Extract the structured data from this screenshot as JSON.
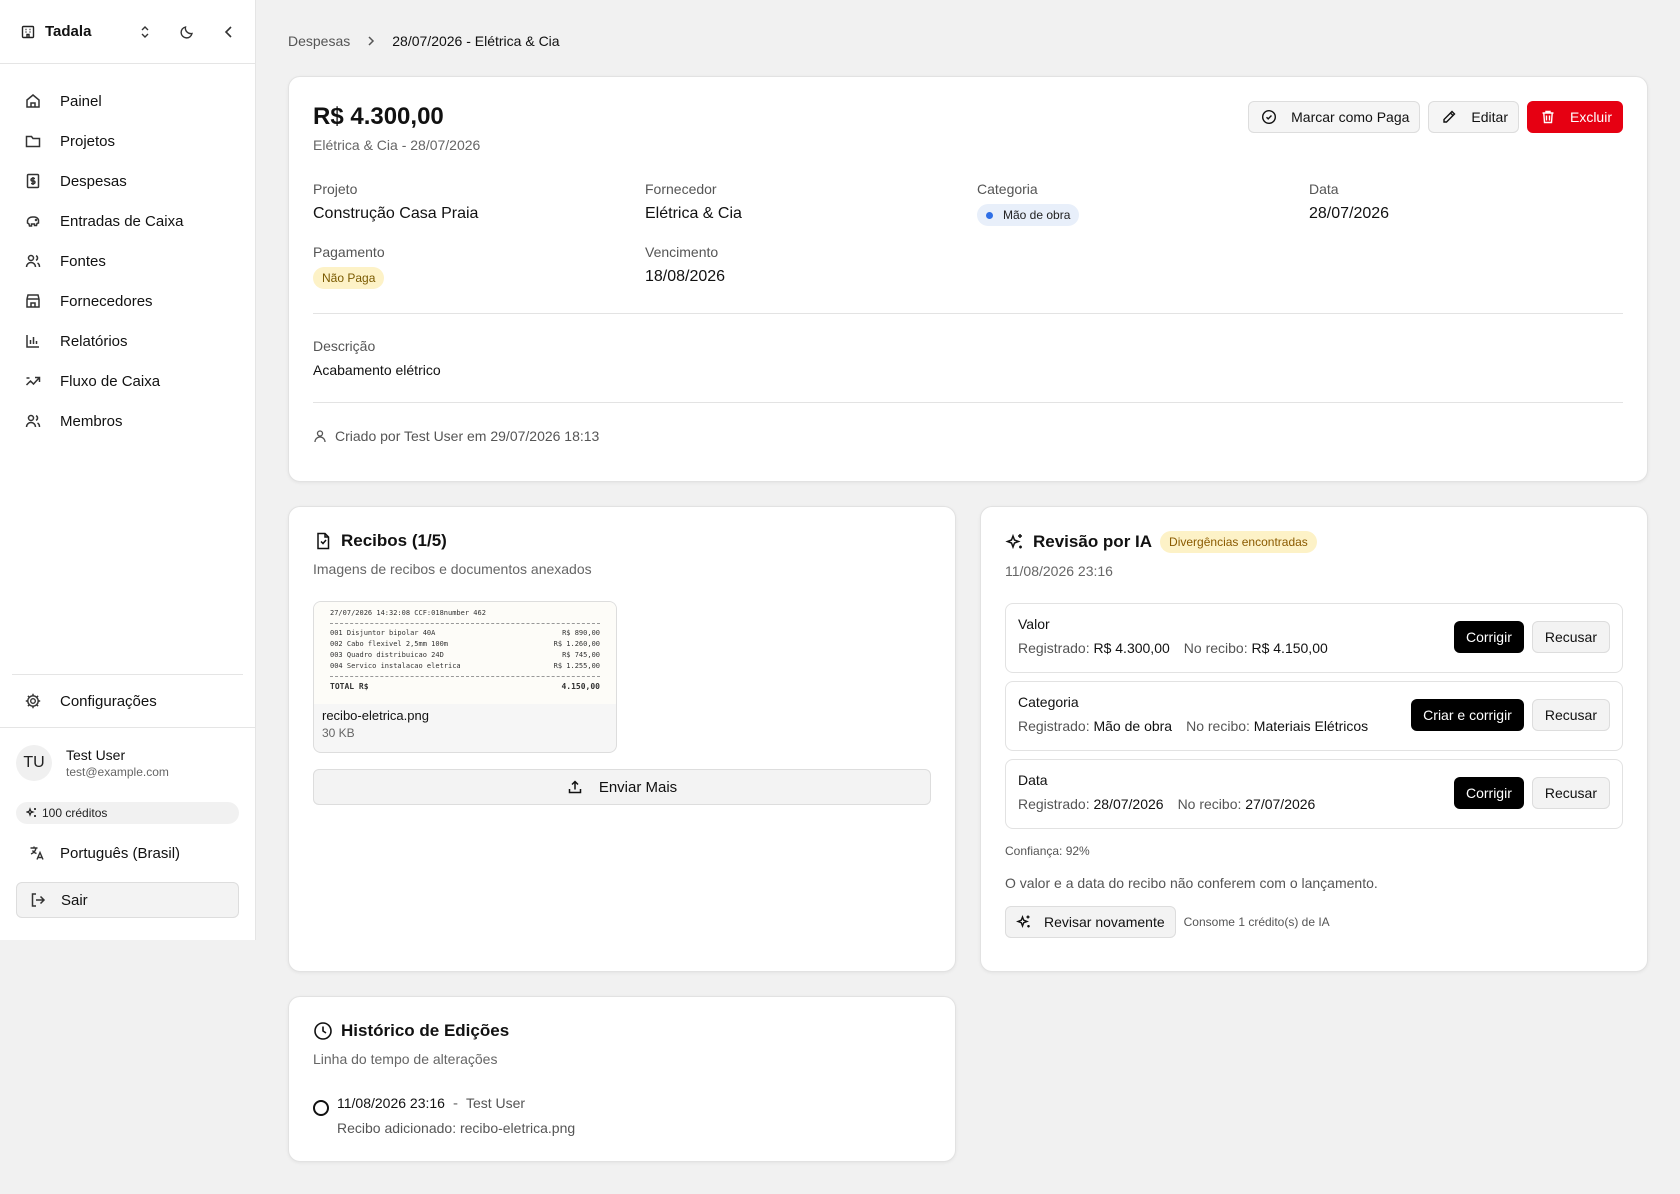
{
  "app": {
    "name": "Tadala"
  },
  "nav": [
    {
      "label": "Painel",
      "icon": "home-icon"
    },
    {
      "label": "Projetos",
      "icon": "folder-icon"
    },
    {
      "label": "Despesas",
      "icon": "receipt-icon"
    },
    {
      "label": "Entradas de Caixa",
      "icon": "piggy-bank-icon"
    },
    {
      "label": "Fontes",
      "icon": "users-icon"
    },
    {
      "label": "Fornecedores",
      "icon": "store-icon"
    },
    {
      "label": "Relatórios",
      "icon": "bar-chart-icon"
    },
    {
      "label": "Fluxo de Caixa",
      "icon": "flow-icon"
    },
    {
      "label": "Membros",
      "icon": "members-icon"
    }
  ],
  "sidebar": {
    "settings": "Configurações",
    "user": {
      "initials": "TU",
      "name": "Test User",
      "email": "test@example.com"
    },
    "credits": "100 créditos",
    "language": "Português (Brasil)",
    "logout": "Sair"
  },
  "breadcrumb": {
    "parent": "Despesas",
    "current": "28/07/2026 - Elétrica & Cia"
  },
  "expense": {
    "amount": "R$ 4.300,00",
    "subtitle": "Elétrica & Cia - 28/07/2026",
    "actions": {
      "mark_paid": "Marcar como Paga",
      "edit": "Editar",
      "delete": "Excluir"
    },
    "fields": {
      "project_label": "Projeto",
      "project": "Construção Casa Praia",
      "supplier_label": "Fornecedor",
      "supplier": "Elétrica & Cia",
      "category_label": "Categoria",
      "category": "Mão de obra",
      "date_label": "Data",
      "date": "28/07/2026",
      "payment_label": "Pagamento",
      "payment": "Não Paga",
      "due_label": "Vencimento",
      "due": "18/08/2026"
    },
    "description_label": "Descrição",
    "description": "Acabamento elétrico",
    "created": "Criado por Test User em 29/07/2026 18:13"
  },
  "receipts": {
    "title": "Recibos (1/5)",
    "description": "Imagens de recibos e documentos anexados",
    "file": {
      "name": "recibo-eletrica.png",
      "size": "30 KB",
      "header": "27/07/2026 14:32:08   CCF:018number 462",
      "lines": [
        {
          "item": "001 Disjuntor bipolar 40A",
          "price": "R$ 890,00"
        },
        {
          "item": "002 Cabo flexivel 2,5mm 100m",
          "price": "R$ 1.260,00"
        },
        {
          "item": "003 Quadro distribuicao 24D",
          "price": "R$ 745,00"
        },
        {
          "item": "004 Servico instalacao eletrica",
          "price": "R$ 1.255,00"
        }
      ],
      "total_label": "TOTAL R$",
      "total": "4.150,00"
    },
    "upload": "Enviar Mais"
  },
  "ai_review": {
    "title": "Revisão por IA",
    "badge": "Divergências encontradas",
    "timestamp": "11/08/2026 23:16",
    "registered_label": "Registrado:",
    "receipt_label": "No recibo:",
    "items": [
      {
        "title": "Valor",
        "registered": "R$ 4.300,00",
        "receipt": "R$ 4.150,00",
        "action": "Corrigir",
        "reject": "Recusar"
      },
      {
        "title": "Categoria",
        "registered": "Mão de obra",
        "receipt": "Materiais Elétricos",
        "action": "Criar e corrigir",
        "reject": "Recusar"
      },
      {
        "title": "Data",
        "registered": "28/07/2026",
        "receipt": "27/07/2026",
        "action": "Corrigir",
        "reject": "Recusar"
      }
    ],
    "confidence": "Confiança: 92%",
    "summary": "O valor e a data do recibo não conferem com o lançamento.",
    "rerun": "Revisar novamente",
    "rerun_note": "Consome 1 crédito(s) de IA"
  },
  "history": {
    "title": "Histórico de Edições",
    "description": "Linha do tempo de alterações",
    "entries": [
      {
        "when": "11/08/2026 23:16",
        "sep": "-",
        "who": "Test User",
        "what": "Recibo adicionado: recibo-eletrica.png"
      }
    ]
  },
  "colors": {
    "danger": "#e60012",
    "badge_warn_bg": "#fdf2c7",
    "category_dot": "#2f6fe6",
    "primary": "#000000"
  }
}
